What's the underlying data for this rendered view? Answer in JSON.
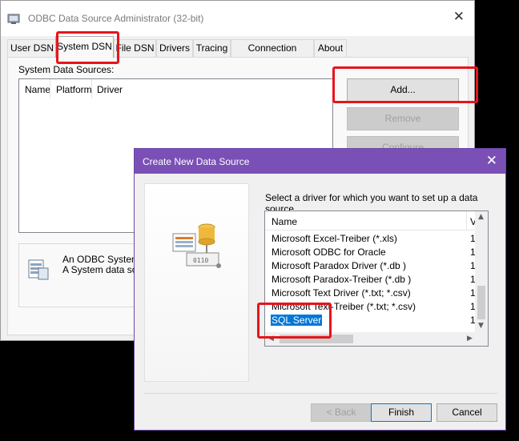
{
  "window": {
    "title": "ODBC Data Source Administrator (32-bit)",
    "close_glyph": "✕"
  },
  "tabs": [
    {
      "label": "User DSN"
    },
    {
      "label": "System DSN",
      "active": true
    },
    {
      "label": "File DSN"
    },
    {
      "label": "Drivers"
    },
    {
      "label": "Tracing"
    },
    {
      "label": "Connection Pooling"
    },
    {
      "label": "About"
    }
  ],
  "system_dsn": {
    "section_label": "System Data Sources:",
    "columns": [
      "Name",
      "Platform",
      "Driver"
    ],
    "buttons": {
      "add": "Add...",
      "remove": "Remove",
      "configure": "Configure"
    },
    "info_line1": "An ODBC System d",
    "info_line2": "A System data sour"
  },
  "dialog": {
    "title": "Create New Data Source",
    "close_glyph": "✕",
    "prompt": "Select a driver for which you want to set up a data source.",
    "columns": {
      "name": "Name",
      "version": "V"
    },
    "drivers": [
      {
        "name": "Microsoft Excel-Treiber (*.xls)",
        "version": "1"
      },
      {
        "name": "Microsoft ODBC for Oracle",
        "version": "1"
      },
      {
        "name": "Microsoft Paradox Driver (*.db )",
        "version": "1"
      },
      {
        "name": "Microsoft Paradox-Treiber (*.db )",
        "version": "1"
      },
      {
        "name": "Microsoft Text Driver (*.txt; *.csv)",
        "version": "1"
      },
      {
        "name": "Microsoft Text-Treiber (*.txt; *.csv)",
        "version": "1"
      },
      {
        "name": "SQL Server",
        "version": "1",
        "selected": true
      }
    ],
    "buttons": {
      "back": "< Back",
      "finish": "Finish",
      "cancel": "Cancel"
    }
  },
  "colors": {
    "dialog_titlebar": "#7b50b6",
    "selection": "#0078d7",
    "highlight": "#e8141c"
  }
}
